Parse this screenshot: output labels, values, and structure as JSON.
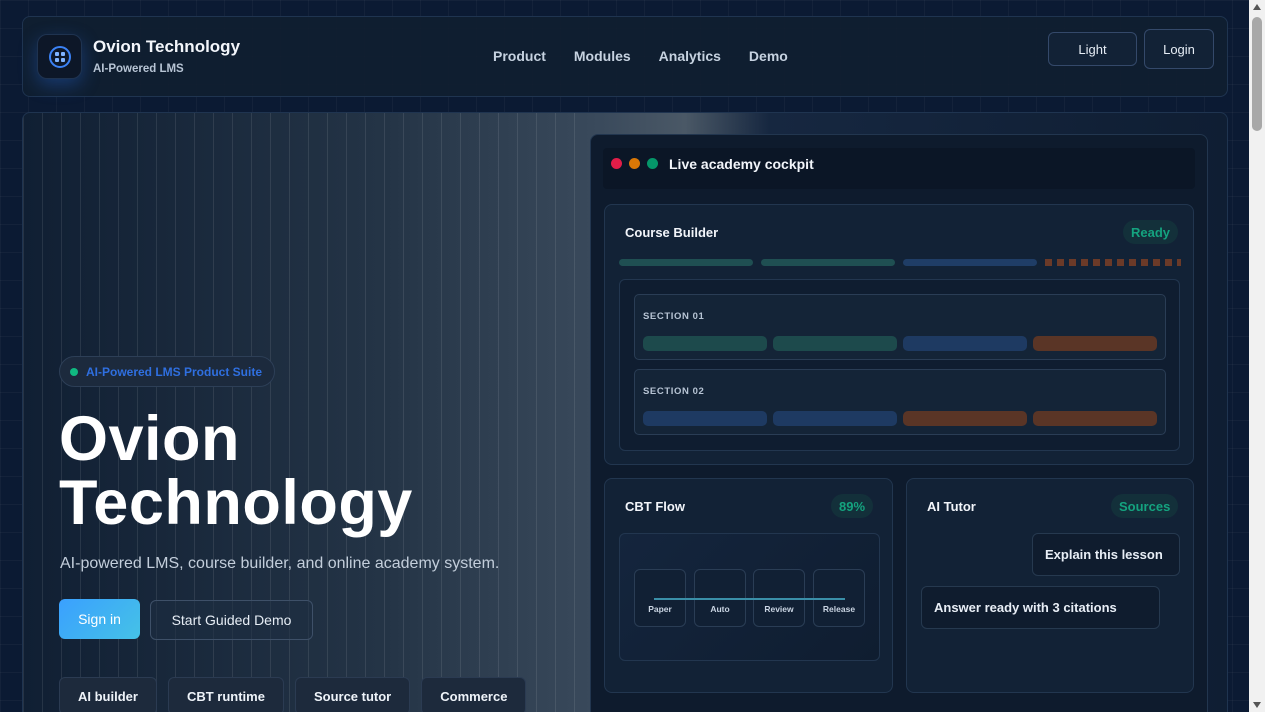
{
  "header": {
    "brand_title": "Ovion Technology",
    "brand_subtitle": "AI-Powered LMS",
    "logo_icon": "grid-logo-icon",
    "nav": [
      "Product",
      "Modules",
      "Analytics",
      "Demo"
    ],
    "light_label": "Light",
    "login_label": "Login"
  },
  "hero": {
    "pill_text": "AI-Powered LMS Product Suite",
    "title_line1": "Ovion",
    "title_line2": "Technology",
    "description": "AI-powered LMS, course builder, and online academy system.",
    "signin_label": "Sign in",
    "demo_label": "Start Guided Demo",
    "chips": [
      "AI builder",
      "CBT runtime",
      "Source tutor",
      "Commerce"
    ]
  },
  "cockpit": {
    "title": "Live academy cockpit",
    "course_builder": {
      "title": "Course Builder",
      "status": "Ready",
      "sections": [
        "SECTION 01",
        "SECTION 02"
      ]
    },
    "cbt_flow": {
      "title": "CBT Flow",
      "percent": "89%",
      "steps": [
        "Paper",
        "Auto",
        "Review",
        "Release"
      ]
    },
    "ai_tutor": {
      "title": "AI Tutor",
      "badge": "Sources",
      "prompt": "Explain this lesson",
      "answer": "Answer ready with 3 citations"
    }
  },
  "colors": {
    "accent_blue": "#3b82f6",
    "ready_green": "#14a37f",
    "dot_red": "#e11d48",
    "dot_amber": "#d97706",
    "dot_green": "#059669"
  }
}
